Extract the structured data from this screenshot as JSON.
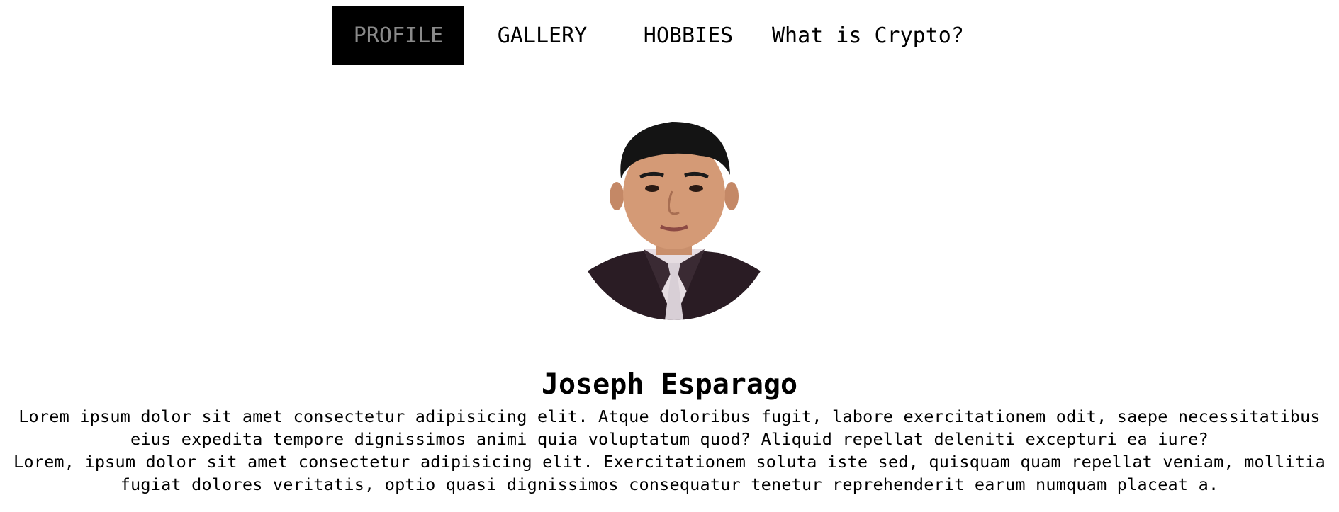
{
  "nav": {
    "items": [
      {
        "label": "PROFILE",
        "active": true
      },
      {
        "label": "GALLERY",
        "active": false
      },
      {
        "label": "HOBBIES",
        "active": false
      },
      {
        "label": "What is Crypto?",
        "active": false
      }
    ]
  },
  "profile": {
    "photo_icon": "profile-photo",
    "name": "Joseph Esparago",
    "paragraphs": [
      "Lorem ipsum dolor sit amet consectetur adipisicing elit. Atque doloribus fugit, labore exercitationem odit, saepe necessitatibus eius expedita tempore dignissimos animi quia voluptatum quod? Aliquid repellat deleniti excepturi ea iure?",
      "Lorem, ipsum dolor sit amet consectetur adipisicing elit. Exercitationem soluta iste sed, quisquam quam repellat veniam, mollitia fugiat dolores veritatis, optio quasi dignissimos consequatur tenetur reprehenderit earum numquam placeat a."
    ]
  },
  "colors": {
    "nav_active_bg": "#000000",
    "nav_active_text": "#8a8a8a",
    "text": "#000000",
    "background": "#ffffff"
  }
}
